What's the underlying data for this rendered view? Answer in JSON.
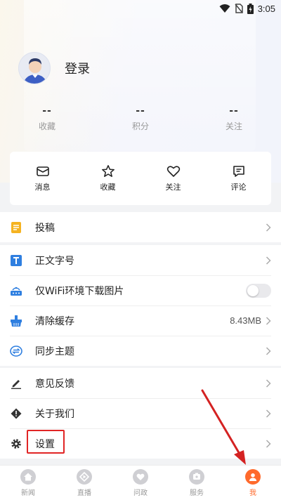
{
  "status_bar": {
    "time": "3:05"
  },
  "profile": {
    "login_label": "登录"
  },
  "stats": [
    {
      "value": "--",
      "label": "收藏"
    },
    {
      "value": "--",
      "label": "积分"
    },
    {
      "value": "--",
      "label": "关注"
    }
  ],
  "quick_actions": [
    {
      "label": "消息",
      "icon": "mail-icon"
    },
    {
      "label": "收藏",
      "icon": "star-icon"
    },
    {
      "label": "关注",
      "icon": "heart-icon"
    },
    {
      "label": "评论",
      "icon": "comment-icon"
    }
  ],
  "menu_group1": [
    {
      "label": "投稿",
      "icon": "document-icon"
    }
  ],
  "menu_group2": [
    {
      "label": "正文字号",
      "icon": "text-size-icon"
    },
    {
      "label": "仅WiFi环境下载图片",
      "icon": "wifi-image-icon",
      "toggle": "off"
    },
    {
      "label": "清除缓存",
      "icon": "broom-icon",
      "value": "8.43MB"
    },
    {
      "label": "同步主题",
      "icon": "sync-icon"
    }
  ],
  "menu_group3": [
    {
      "label": "意见反馈",
      "icon": "pencil-icon"
    },
    {
      "label": "关于我们",
      "icon": "info-diamond-icon"
    },
    {
      "label": "设置",
      "icon": "gear-icon"
    }
  ],
  "tabbar": [
    {
      "label": "新闻",
      "icon": "home-icon",
      "active": false
    },
    {
      "label": "直播",
      "icon": "live-icon",
      "active": false
    },
    {
      "label": "问政",
      "icon": "heart-chat-icon",
      "active": false
    },
    {
      "label": "服务",
      "icon": "service-icon",
      "active": false
    },
    {
      "label": "我",
      "icon": "user-icon",
      "active": true
    }
  ],
  "colors": {
    "accent": "#ff6a2c",
    "annotation": "#e12525",
    "icon_blue": "#2f7fe0",
    "icon_yellow": "#f5b321"
  }
}
